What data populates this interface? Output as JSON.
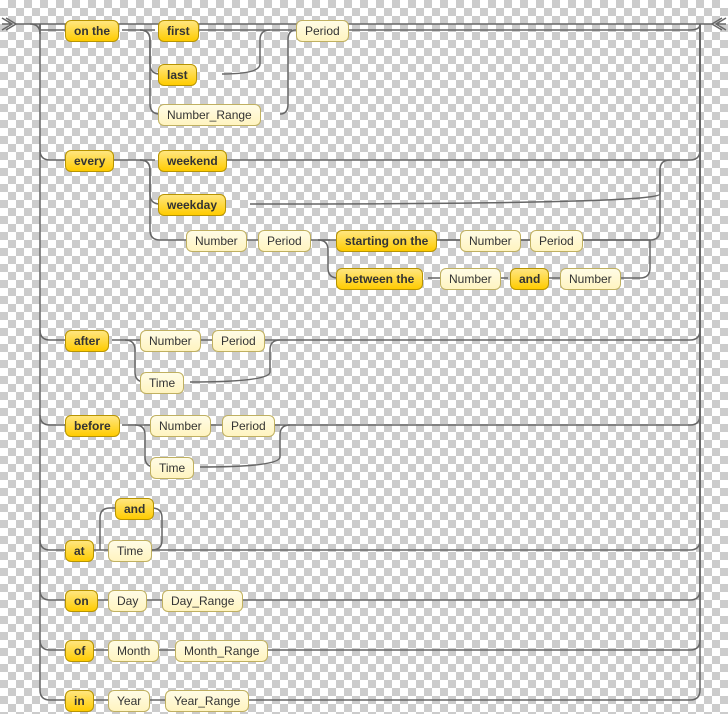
{
  "diagram": {
    "type": "railroad",
    "entry_marker": "left",
    "exit_marker": "right"
  },
  "nodes": {
    "on_the": "on the",
    "first": "first",
    "last": "last",
    "number_range": "Number_Range",
    "period": "Period",
    "every": "every",
    "weekend": "weekend",
    "weekday": "weekday",
    "number": "Number",
    "starting_on_the": "starting on the",
    "between_the": "between the",
    "and": "and",
    "after": "after",
    "time": "Time",
    "before": "before",
    "at": "at",
    "on": "on",
    "day": "Day",
    "day_range": "Day_Range",
    "of": "of",
    "month": "Month",
    "month_range": "Month_Range",
    "in": "in",
    "year": "Year",
    "year_range": "Year_Range"
  }
}
